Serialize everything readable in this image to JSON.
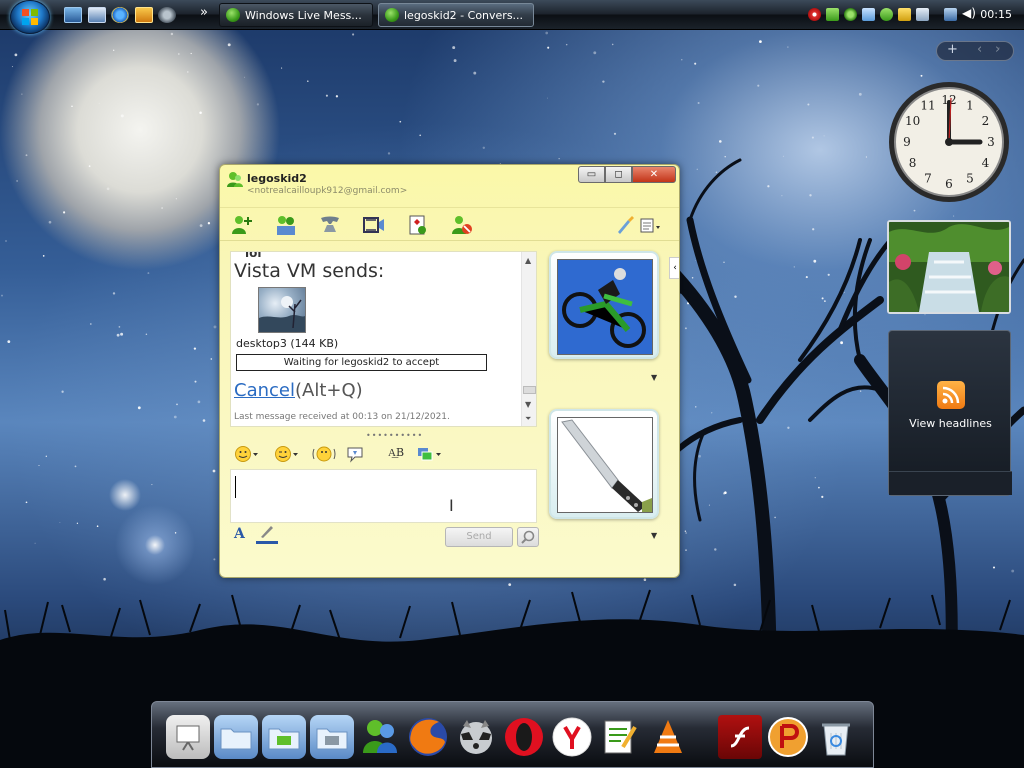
{
  "taskbar": {
    "tasks": [
      {
        "label": "Windows Live Mess..."
      },
      {
        "label": "legoskid2 - Convers..."
      }
    ],
    "overflow_label": "»",
    "time": "00:15"
  },
  "gadgets": {
    "controls_plus": "+",
    "controls_prev": "‹",
    "controls_next": "›",
    "feed_label": "View headlines"
  },
  "messenger": {
    "contact_name": "legoskid2",
    "contact_email": "<notrealcailloupk912@gmail.com>",
    "window_buttons": {
      "minimize": "▭",
      "maximize": "◻",
      "close": "✕"
    },
    "history": {
      "top_cut_text": "lol",
      "sender_text": "Vista VM sends:",
      "file_label": "desktop3 (144 KB)",
      "waiting_text": "Waiting for legoskid2 to accept",
      "cancel_link": "Cancel",
      "cancel_shortcut": "(Alt+Q)",
      "last_message": "Last message received at 00:13 on 21/12/2021."
    },
    "splitter": "••••••••••",
    "send_label": "Send",
    "font_label": "A"
  },
  "colors": {
    "window_yellow": "#fbf8a8",
    "link_blue": "#2a6bc2",
    "rss_orange": "#f07a12"
  }
}
